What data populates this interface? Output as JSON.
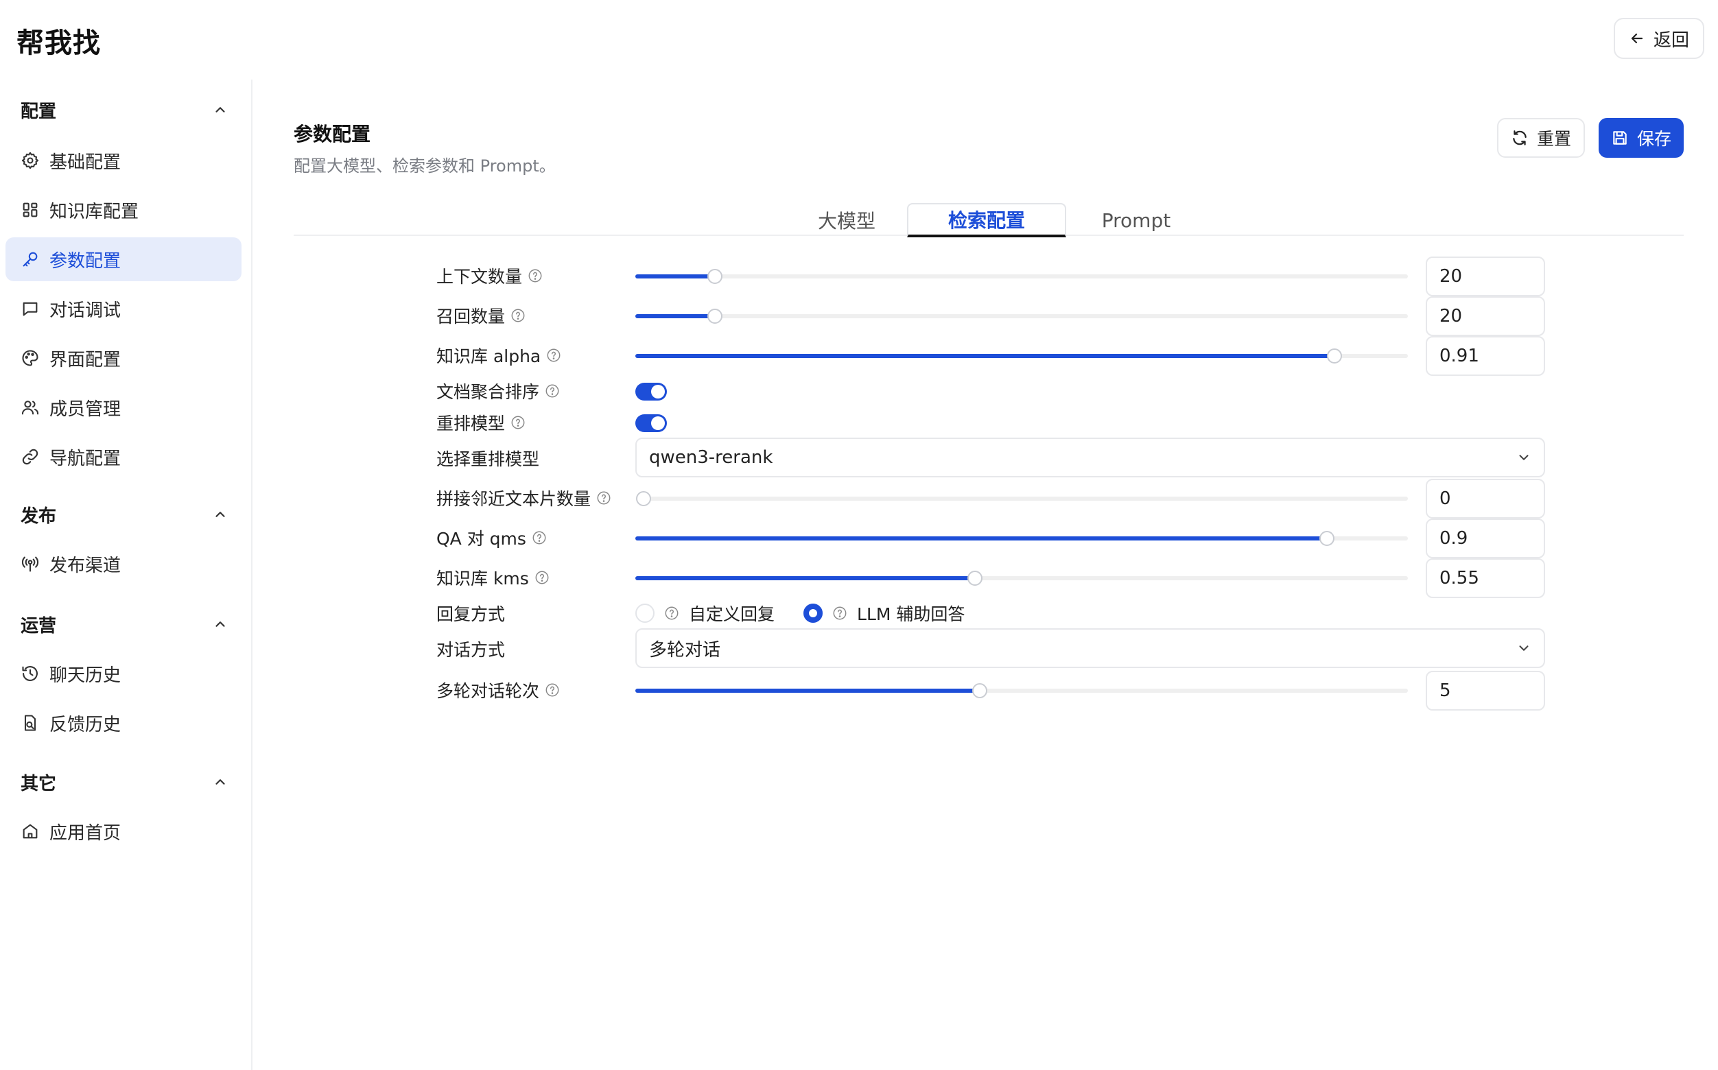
{
  "app": {
    "title": "帮我找",
    "back_label": "返回"
  },
  "sidebar": {
    "groups": [
      {
        "title": "配置",
        "items": [
          {
            "label": "基础配置",
            "icon": "gear-icon"
          },
          {
            "label": "知识库配置",
            "icon": "grid-icon"
          },
          {
            "label": "参数配置",
            "icon": "key-icon",
            "active": true
          },
          {
            "label": "对话调试",
            "icon": "chat-icon"
          },
          {
            "label": "界面配置",
            "icon": "palette-icon"
          },
          {
            "label": "成员管理",
            "icon": "users-icon"
          },
          {
            "label": "导航配置",
            "icon": "link-icon"
          }
        ]
      },
      {
        "title": "发布",
        "items": [
          {
            "label": "发布渠道",
            "icon": "broadcast-icon"
          }
        ]
      },
      {
        "title": "运营",
        "items": [
          {
            "label": "聊天历史",
            "icon": "history-icon"
          },
          {
            "label": "反馈历史",
            "icon": "feedback-icon"
          }
        ]
      },
      {
        "title": "其它",
        "items": [
          {
            "label": "应用首页",
            "icon": "home-icon"
          }
        ]
      }
    ]
  },
  "main": {
    "title": "参数配置",
    "subtitle": "配置大模型、检索参数和 Prompt。",
    "reset_label": "重置",
    "save_label": "保存",
    "tabs": [
      {
        "label": "大模型"
      },
      {
        "label": "检索配置",
        "active": true
      },
      {
        "label": "Prompt"
      }
    ]
  },
  "form": {
    "context_count": {
      "label": "上下文数量",
      "value": "20",
      "fraction": 0.103
    },
    "recall_count": {
      "label": "召回数量",
      "value": "20",
      "fraction": 0.103
    },
    "kb_alpha": {
      "label": "知识库 alpha",
      "value": "0.91",
      "fraction": 0.905
    },
    "doc_aggregate_sort": {
      "label": "文档聚合排序",
      "enabled": true
    },
    "rerank_model": {
      "label": "重排模型",
      "enabled": true
    },
    "select_rerank_model": {
      "label": "选择重排模型",
      "value": "qwen3-rerank"
    },
    "adjacent_chunks": {
      "label": "拼接邻近文本片数量",
      "value": "0",
      "fraction": 0.0
    },
    "qa_qms": {
      "label": "QA 对 qms",
      "value": "0.9",
      "fraction": 0.895
    },
    "kb_kms": {
      "label": "知识库 kms",
      "value": "0.55",
      "fraction": 0.44
    },
    "reply_mode": {
      "label": "回复方式",
      "options": [
        "自定义回复",
        "LLM 辅助回答"
      ],
      "selected": "LLM 辅助回答"
    },
    "dialog_mode": {
      "label": "对话方式",
      "value": "多轮对话"
    },
    "multi_turn_count": {
      "label": "多轮对话轮次",
      "value": "5",
      "fraction": 0.446
    }
  },
  "colors": {
    "accent": "#1d4ed8",
    "active_bg": "#e6ecfb"
  }
}
